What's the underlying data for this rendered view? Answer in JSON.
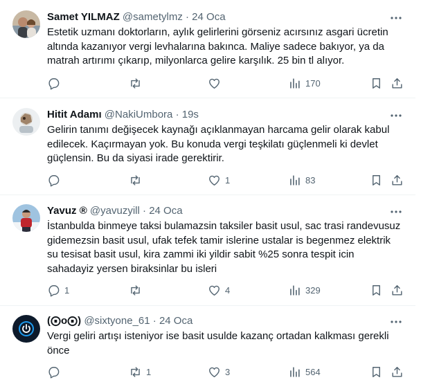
{
  "tweets": [
    {
      "name": "Samet YILMAZ",
      "handle": "@sametylmz",
      "time": "24 Oca",
      "text": "Estetik uzmanı doktorların, aylık gelirlerini görseniz acırsınız asgari ücretin altında kazanıyor vergi levhalarına bakınca. Maliye sadece bakıyor, ya da matrah artırımı çıkarıp, milyonlarca gelire karşılık. 25 bin tl alıyor.",
      "replies": "",
      "retweets": "",
      "likes": "",
      "views": "170"
    },
    {
      "name": "Hitit Adamı",
      "handle": "@NakiUmbora",
      "time": "19s",
      "text": "Gelirin tanımı değişecek kaynağı açıklanmayan harcama gelir olarak kabul edilecek. Kaçırmayan yok. Bu konuda vergi teşkilatı güçlenmeli ki devlet güçlensin. Bu da siyasi irade gerektirir.",
      "replies": "",
      "retweets": "",
      "likes": "1",
      "views": "83"
    },
    {
      "name": "Yavuz ®",
      "handle": "@yavuzyill",
      "time": "24 Oca",
      "text": "İstanbulda binmeye taksi bulamazsin taksiler basit usul, sac trasi randevusuz gidemezsin basit usul, ufak tefek tamir islerine ustalar is begenmez elektrik su tesisat basit usul, kira zammi iki yildir sabit %25 sonra tespit icin sahadayiz yersen biraksinlar bu isleri",
      "replies": "1",
      "retweets": "",
      "likes": "4",
      "views": "329"
    },
    {
      "name": "(⨀o⨀)",
      "handle": "@sixtyone_61",
      "time": "24 Oca",
      "text": "Vergi geliri artışı isteniyor ise basit usulde kazanç ortadan kalkması gerekli önce",
      "replies": "",
      "retweets": "1",
      "likes": "3",
      "views": "564"
    }
  ],
  "separator": "·",
  "icons": {
    "reply": "reply-icon",
    "retweet": "retweet-icon",
    "like": "heart-icon",
    "views": "views-icon",
    "bookmark": "bookmark-icon",
    "share": "share-icon",
    "more": "more-icon"
  },
  "colors": {
    "text": "#0f1419",
    "secondary": "#536471",
    "divider": "#eff3f4",
    "avatar4": "#1d9bf0"
  }
}
